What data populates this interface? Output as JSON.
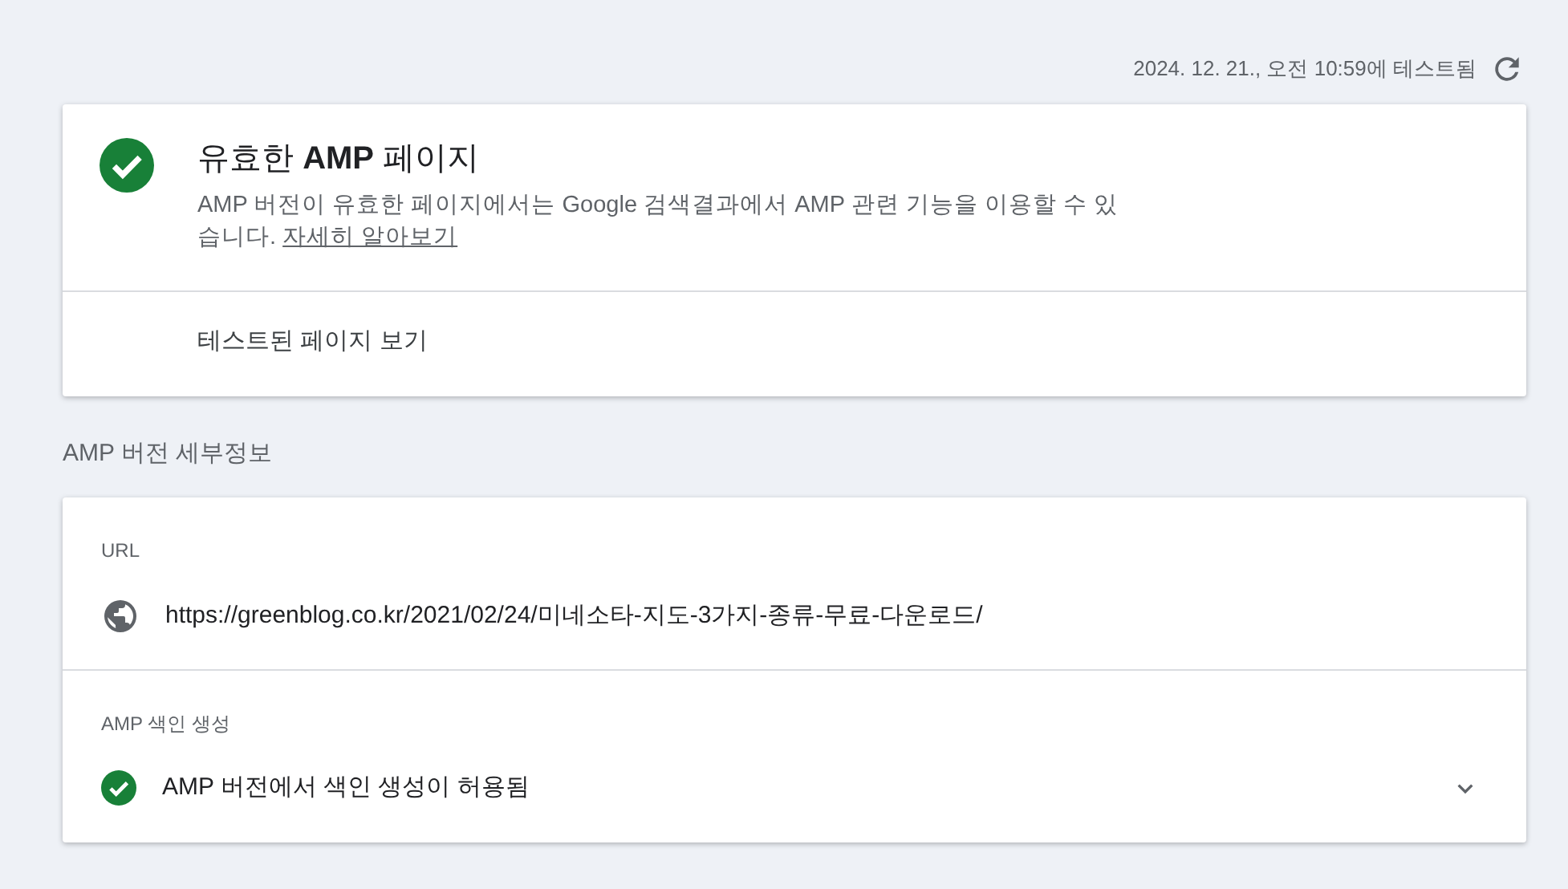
{
  "test_status": {
    "timestamp": "2024. 12. 21., 오전 10:59에 테스트됨"
  },
  "summary_card": {
    "valid": true,
    "title": "유효한 **AMP** 페이지",
    "description": "AMP 버전이 유효한 페이지에서는 Google 검색결과에서 AMP 관련 기능을 이용할 수 있습니다.",
    "link": "자세히 알아보기",
    "action": "테스트된 페이지 보기"
  },
  "details": {
    "heading": "AMP 버전 세부정보",
    "sections": [
      {
        "label": "URL",
        "kind": "url",
        "value": "https://greenblog.co.kr/2021/02/24/미네소타-지도-3가지-종류-무료-다운로드/"
      },
      {
        "label": "AMP 색인 생성",
        "kind": "status",
        "valid": true,
        "value": "AMP 버전에서 색인 생성이 허용됨",
        "expanded": false
      }
    ]
  }
}
